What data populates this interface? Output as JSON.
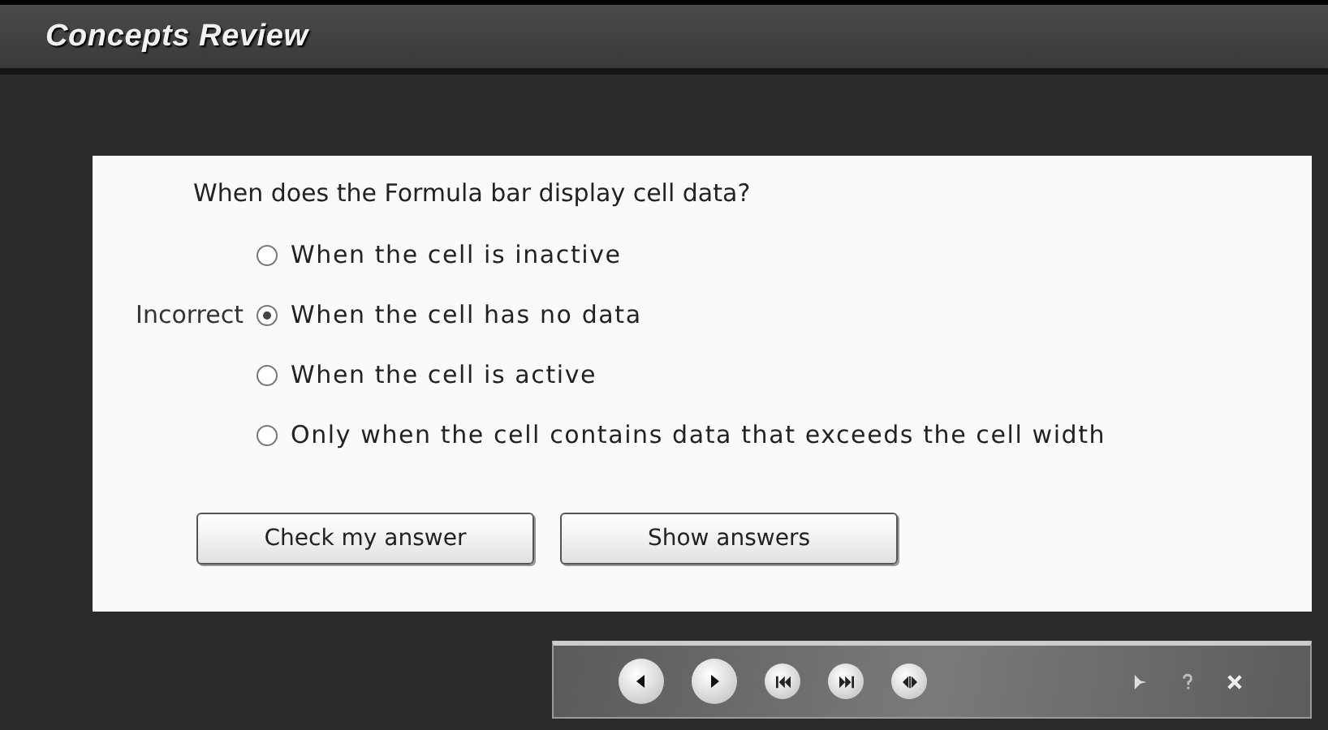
{
  "window": {
    "title": "Concepts Review"
  },
  "question": {
    "text": "When does the Formula bar display cell data?",
    "options": [
      {
        "label": "When the cell is inactive",
        "selected": false
      },
      {
        "label": "When the cell has no data",
        "selected": true,
        "feedback": "Incorrect"
      },
      {
        "label": "When the cell is active",
        "selected": false
      },
      {
        "label": "Only when the cell contains data that exceeds the cell width",
        "selected": false
      }
    ]
  },
  "buttons": [
    "Check my answer",
    "Show answers"
  ]
}
